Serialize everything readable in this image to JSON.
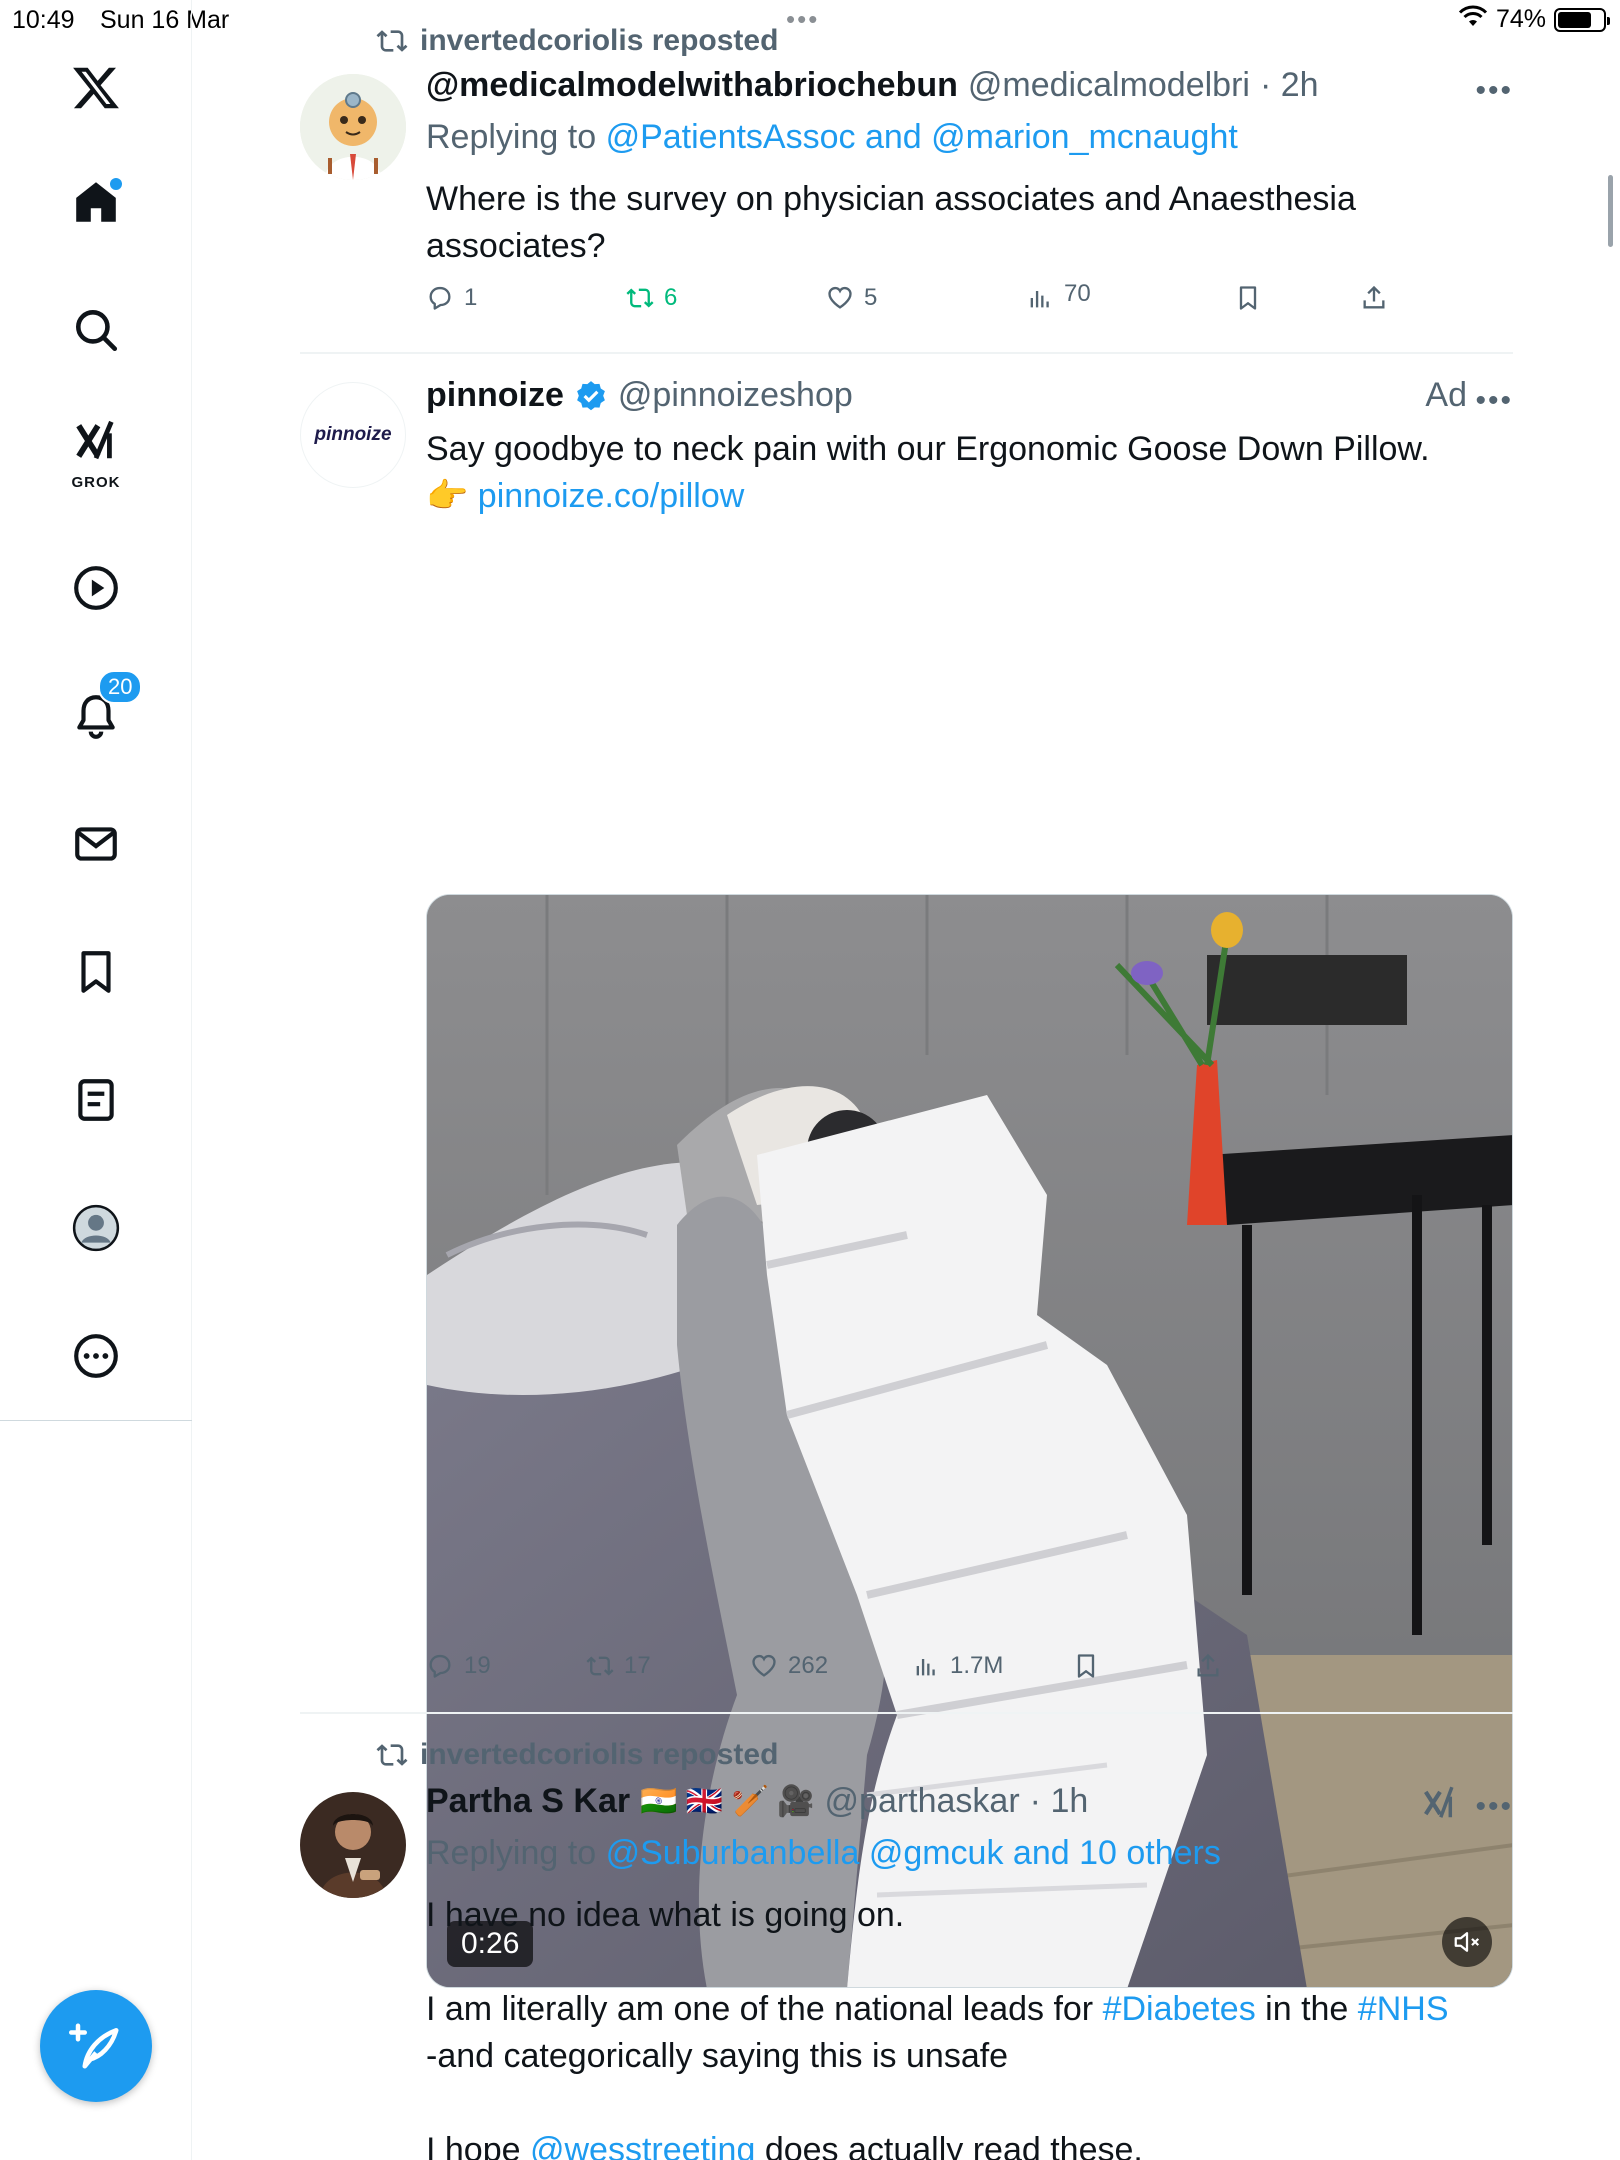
{
  "status_bar": {
    "time": "10:49",
    "date": "Sun 16 Mar",
    "battery": "74%",
    "battery_level": 0.74
  },
  "nav": {
    "notifications_badge": "20",
    "grok_label": "GROK"
  },
  "posts": [
    {
      "repost_label": "invertedcoriolis reposted",
      "name": "@medicalmodelwithabriochebun",
      "handle": "@medicalmodelbri",
      "time": "· 2h",
      "reply_prefix": "Replying to",
      "reply_to": "@PatientsAssoc and @marion_mcnaught",
      "text": "Where is the survey on physician associates and Anaesthesia associates?",
      "replies": "1",
      "reposts": "6",
      "likes": "5",
      "views": "70"
    },
    {
      "name": "pinnoize",
      "handle": "@pinnoizeshop",
      "ad_label": "Ad",
      "avatar_text": "pinnoize",
      "text": "Say goodbye to neck pain with our Ergonomic Goose Down Pillow.",
      "link_emoji": "👉",
      "link": "pinnoize.co/pillow",
      "video_duration": "0:26",
      "replies": "19",
      "reposts": "17",
      "likes": "262",
      "views": "1.7M"
    },
    {
      "repost_label": "invertedcoriolis reposted",
      "name": "Partha S Kar",
      "flags": "🇮🇳 🇬🇧 🏏 🎥",
      "handle": "@parthaskar",
      "time": "· 1h",
      "reply_prefix": "Replying to",
      "reply_to": "@Suburbanbella @gmcuk and 10 others",
      "line1": "I have no idea what is going on.",
      "line2_a": "I am literally am one of the national leads for",
      "hashtag1": "#Diabetes",
      "line2_b": "in the",
      "hashtag2": "#NHS",
      "line3": "-and categorically saying this is unsafe",
      "line4_a": "I hope",
      "mention": "@wesstreeting",
      "line4_b": "does actually read these."
    }
  ]
}
